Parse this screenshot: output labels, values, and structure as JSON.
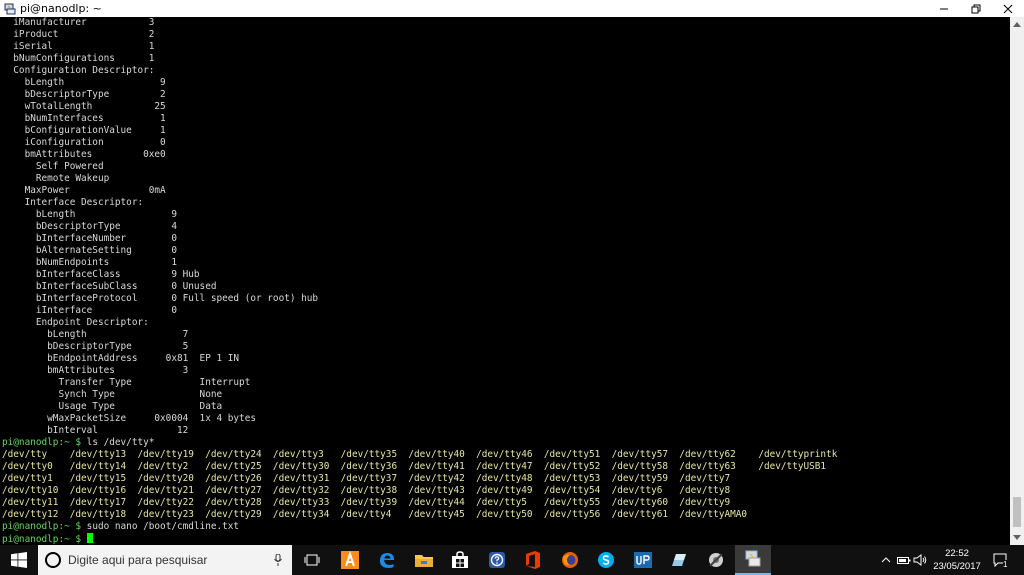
{
  "window": {
    "title": "pi@nanodlp: ~"
  },
  "terminal": {
    "lines": [
      "  iManufacturer           3",
      "  iProduct                2",
      "  iSerial                 1",
      "  bNumConfigurations      1",
      "  Configuration Descriptor:",
      "    bLength                 9",
      "    bDescriptorType         2",
      "    wTotalLength           25",
      "    bNumInterfaces          1",
      "    bConfigurationValue     1",
      "    iConfiguration          0",
      "    bmAttributes         0xe0",
      "      Self Powered",
      "      Remote Wakeup",
      "    MaxPower              0mA",
      "    Interface Descriptor:",
      "      bLength                 9",
      "      bDescriptorType         4",
      "      bInterfaceNumber        0",
      "      bAlternateSetting       0",
      "      bNumEndpoints           1",
      "      bInterfaceClass         9 Hub",
      "      bInterfaceSubClass      0 Unused",
      "      bInterfaceProtocol      0 Full speed (or root) hub",
      "      iInterface              0",
      "      Endpoint Descriptor:",
      "        bLength                 7",
      "        bDescriptorType         5",
      "        bEndpointAddress     0x81  EP 1 IN",
      "        bmAttributes            3",
      "          Transfer Type            Interrupt",
      "          Synch Type               None",
      "          Usage Type               Data",
      "        wMaxPacketSize     0x0004  1x 4 bytes",
      "        bInterval              12"
    ],
    "prompt": "pi@nanodlp:~ $ ",
    "commands": [
      "ls /dev/tty*",
      "sudo nano /boot/cmdline.txt",
      ""
    ],
    "ls_output": [
      "/dev/tty    /dev/tty13  /dev/tty19  /dev/tty24  /dev/tty3   /dev/tty35  /dev/tty40  /dev/tty46  /dev/tty51  /dev/tty57  /dev/tty62    /dev/ttyprintk",
      "/dev/tty0   /dev/tty14  /dev/tty2   /dev/tty25  /dev/tty30  /dev/tty36  /dev/tty41  /dev/tty47  /dev/tty52  /dev/tty58  /dev/tty63    /dev/ttyUSB1",
      "/dev/tty1   /dev/tty15  /dev/tty20  /dev/tty26  /dev/tty31  /dev/tty37  /dev/tty42  /dev/tty48  /dev/tty53  /dev/tty59  /dev/tty7",
      "/dev/tty10  /dev/tty16  /dev/tty21  /dev/tty27  /dev/tty32  /dev/tty38  /dev/tty43  /dev/tty49  /dev/tty54  /dev/tty6   /dev/tty8",
      "/dev/tty11  /dev/tty17  /dev/tty22  /dev/tty28  /dev/tty33  /dev/tty39  /dev/tty44  /dev/tty5   /dev/tty55  /dev/tty60  /dev/tty9",
      "/dev/tty12  /dev/tty18  /dev/tty23  /dev/tty29  /dev/tty34  /dev/tty4   /dev/tty45  /dev/tty50  /dev/tty56  /dev/tty61  /dev/ttyAMA0"
    ]
  },
  "taskbar": {
    "search_placeholder": "Digite aqui para pesquisar",
    "apps": [
      "task-view-icon",
      "app-orange-icon",
      "edge-icon",
      "file-explorer-icon",
      "store-icon",
      "help-icon",
      "office-icon",
      "firefox-icon",
      "skype-icon",
      "up-app-icon",
      "paint-icon",
      "tools-icon",
      "terminal-app-icon"
    ],
    "clock_time": "22:52",
    "clock_date": "23/05/2017",
    "notification_count": "1"
  },
  "colors": {
    "terminal_bg": "#000000",
    "terminal_fg": "#d8d8d8",
    "ls_fg": "#e6e6a0",
    "prompt": "#5fd75f",
    "cursor": "#00ff00",
    "taskbar_bg": "#101010"
  }
}
